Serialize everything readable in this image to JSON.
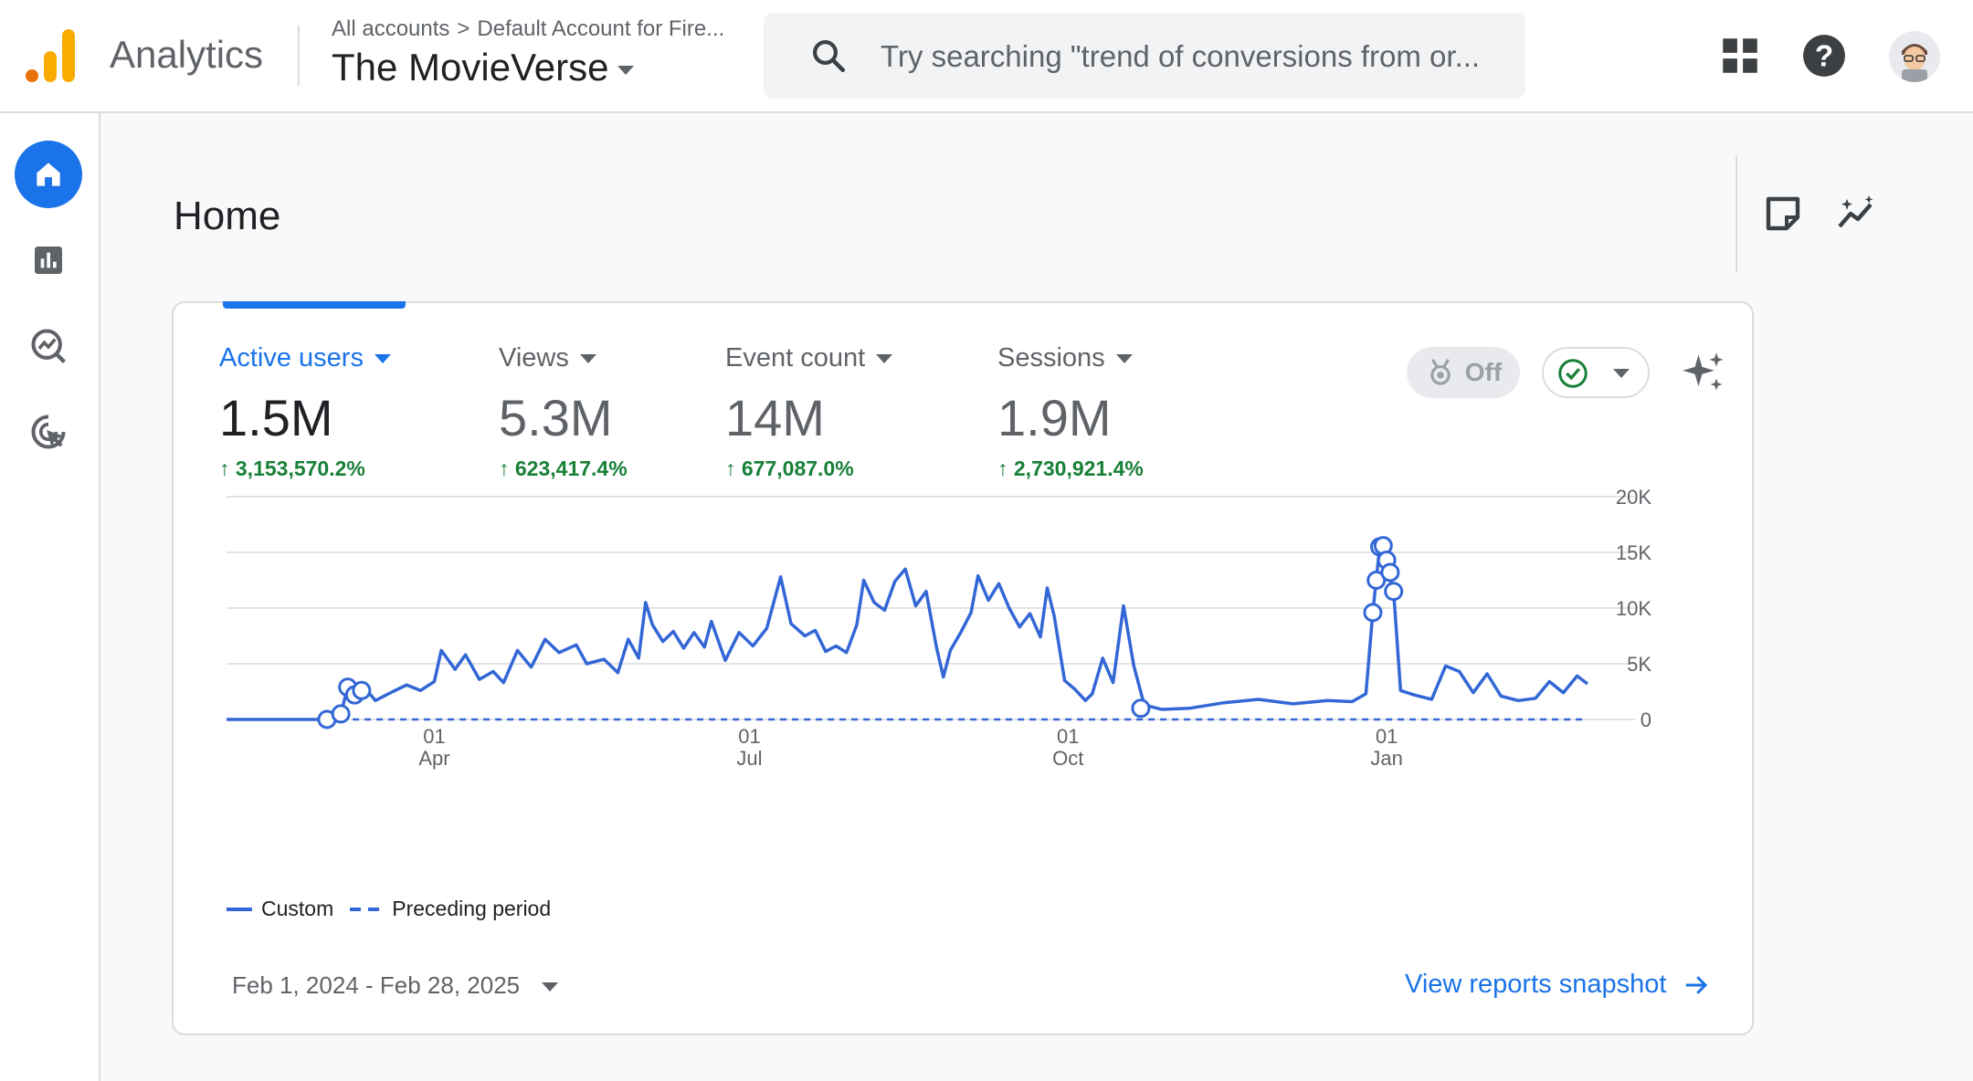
{
  "app": {
    "name": "Analytics"
  },
  "breadcrumb": {
    "all_accounts": "All accounts",
    "separator": ">",
    "account": "Default Account for Fire..."
  },
  "property": {
    "name": "The MovieVerse"
  },
  "search": {
    "placeholder": "Try searching \"trend of conversions from or..."
  },
  "page": {
    "title": "Home"
  },
  "metrics": [
    {
      "label": "Active users",
      "value": "1.5M",
      "delta": "3,153,570.2%"
    },
    {
      "label": "Views",
      "value": "5.3M",
      "delta": "623,417.4%"
    },
    {
      "label": "Event count",
      "value": "14M",
      "delta": "677,087.0%"
    },
    {
      "label": "Sessions",
      "value": "1.9M",
      "delta": "2,730,921.4%"
    }
  ],
  "toggle": {
    "label": "Off"
  },
  "legend": {
    "series1": "Custom",
    "series2": "Preceding period"
  },
  "date_range": "Feb 1, 2024 - Feb 28, 2025",
  "snapshot_link": "View reports snapshot",
  "colors": {
    "accent": "#1a73e8",
    "line": "#3367d6",
    "positive": "#188038"
  },
  "chart_data": {
    "type": "line",
    "ylim": [
      0,
      20000
    ],
    "y_ticks": [
      "20K",
      "15K",
      "10K",
      "5K",
      "0"
    ],
    "x_ticks": [
      {
        "day": "01",
        "month": "Apr",
        "date": "2024-04-01"
      },
      {
        "day": "01",
        "month": "Jul",
        "date": "2024-07-01"
      },
      {
        "day": "01",
        "month": "Oct",
        "date": "2024-10-01"
      },
      {
        "day": "01",
        "month": "Jan",
        "date": "2025-01-01"
      }
    ],
    "series": [
      {
        "name": "Custom",
        "style": "solid",
        "points": [
          [
            "2024-02-01",
            0
          ],
          [
            "2024-02-20",
            0
          ],
          [
            "2024-03-01",
            0
          ],
          [
            "2024-03-05",
            500
          ],
          [
            "2024-03-07",
            2900
          ],
          [
            "2024-03-09",
            2100
          ],
          [
            "2024-03-12",
            2800
          ],
          [
            "2024-03-15",
            1700
          ],
          [
            "2024-03-20",
            2500
          ],
          [
            "2024-03-24",
            3100
          ],
          [
            "2024-03-28",
            2600
          ],
          [
            "2024-04-01",
            3400
          ],
          [
            "2024-04-03",
            6200
          ],
          [
            "2024-04-07",
            4500
          ],
          [
            "2024-04-10",
            5800
          ],
          [
            "2024-04-14",
            3600
          ],
          [
            "2024-04-18",
            4300
          ],
          [
            "2024-04-21",
            3300
          ],
          [
            "2024-04-25",
            6200
          ],
          [
            "2024-04-29",
            4700
          ],
          [
            "2024-05-03",
            7200
          ],
          [
            "2024-05-07",
            6000
          ],
          [
            "2024-05-12",
            6700
          ],
          [
            "2024-05-15",
            5000
          ],
          [
            "2024-05-20",
            5400
          ],
          [
            "2024-05-24",
            4200
          ],
          [
            "2024-05-27",
            7200
          ],
          [
            "2024-05-30",
            5500
          ],
          [
            "2024-06-01",
            10500
          ],
          [
            "2024-06-03",
            8500
          ],
          [
            "2024-06-06",
            7000
          ],
          [
            "2024-06-09",
            7900
          ],
          [
            "2024-06-12",
            6400
          ],
          [
            "2024-06-15",
            7800
          ],
          [
            "2024-06-18",
            6500
          ],
          [
            "2024-06-20",
            8800
          ],
          [
            "2024-06-24",
            5300
          ],
          [
            "2024-06-28",
            7800
          ],
          [
            "2024-07-02",
            6600
          ],
          [
            "2024-07-06",
            8200
          ],
          [
            "2024-07-10",
            12800
          ],
          [
            "2024-07-13",
            8600
          ],
          [
            "2024-07-17",
            7500
          ],
          [
            "2024-07-20",
            8000
          ],
          [
            "2024-07-23",
            6100
          ],
          [
            "2024-07-26",
            6600
          ],
          [
            "2024-07-29",
            6000
          ],
          [
            "2024-08-01",
            8500
          ],
          [
            "2024-08-03",
            12500
          ],
          [
            "2024-08-06",
            10500
          ],
          [
            "2024-08-09",
            9800
          ],
          [
            "2024-08-12",
            12400
          ],
          [
            "2024-08-15",
            13500
          ],
          [
            "2024-08-18",
            10200
          ],
          [
            "2024-08-21",
            11500
          ],
          [
            "2024-08-24",
            6500
          ],
          [
            "2024-08-26",
            3800
          ],
          [
            "2024-08-28",
            6200
          ],
          [
            "2024-08-31",
            7800
          ],
          [
            "2024-09-03",
            9600
          ],
          [
            "2024-09-05",
            12900
          ],
          [
            "2024-09-08",
            10700
          ],
          [
            "2024-09-11",
            12200
          ],
          [
            "2024-09-14",
            10000
          ],
          [
            "2024-09-17",
            8300
          ],
          [
            "2024-09-20",
            9500
          ],
          [
            "2024-09-23",
            7400
          ],
          [
            "2024-09-25",
            11800
          ],
          [
            "2024-09-27",
            9300
          ],
          [
            "2024-09-30",
            3500
          ],
          [
            "2024-10-03",
            2700
          ],
          [
            "2024-10-06",
            1700
          ],
          [
            "2024-10-08",
            2300
          ],
          [
            "2024-10-11",
            5500
          ],
          [
            "2024-10-14",
            3300
          ],
          [
            "2024-10-17",
            10200
          ],
          [
            "2024-10-20",
            4800
          ],
          [
            "2024-10-23",
            1300
          ],
          [
            "2024-10-28",
            900
          ],
          [
            "2024-11-05",
            1000
          ],
          [
            "2024-11-15",
            1500
          ],
          [
            "2024-11-25",
            1800
          ],
          [
            "2024-12-05",
            1400
          ],
          [
            "2024-12-15",
            1700
          ],
          [
            "2024-12-22",
            1600
          ],
          [
            "2024-12-26",
            2300
          ],
          [
            "2024-12-28",
            9600
          ],
          [
            "2024-12-30",
            15500
          ],
          [
            "2025-01-01",
            15800
          ],
          [
            "2025-01-02",
            12500
          ],
          [
            "2025-01-03",
            11500
          ],
          [
            "2025-01-05",
            2600
          ],
          [
            "2025-01-09",
            2200
          ],
          [
            "2025-01-14",
            1800
          ],
          [
            "2025-01-18",
            4800
          ],
          [
            "2025-01-22",
            4300
          ],
          [
            "2025-01-26",
            2400
          ],
          [
            "2025-01-30",
            4100
          ],
          [
            "2025-02-03",
            2100
          ],
          [
            "2025-02-08",
            1700
          ],
          [
            "2025-02-13",
            1900
          ],
          [
            "2025-02-17",
            3400
          ],
          [
            "2025-02-21",
            2400
          ],
          [
            "2025-02-25",
            3900
          ],
          [
            "2025-02-28",
            3200
          ]
        ]
      },
      {
        "name": "Preceding period",
        "style": "dashed",
        "points": [
          [
            "2024-03-05",
            0
          ],
          [
            "2025-02-28",
            0
          ]
        ]
      }
    ],
    "markers": [
      [
        "2024-03-01",
        0
      ],
      [
        "2024-03-05",
        500
      ],
      [
        "2024-03-07",
        2900
      ],
      [
        "2024-03-09",
        2200
      ],
      [
        "2024-03-11",
        2600
      ],
      [
        "2024-10-22",
        1000
      ],
      [
        "2024-12-28",
        9600
      ],
      [
        "2024-12-29",
        12500
      ],
      [
        "2024-12-30",
        15500
      ],
      [
        "2024-12-31",
        15600
      ],
      [
        "2025-01-01",
        14300
      ],
      [
        "2025-01-02",
        13200
      ],
      [
        "2025-01-03",
        11500
      ]
    ]
  }
}
